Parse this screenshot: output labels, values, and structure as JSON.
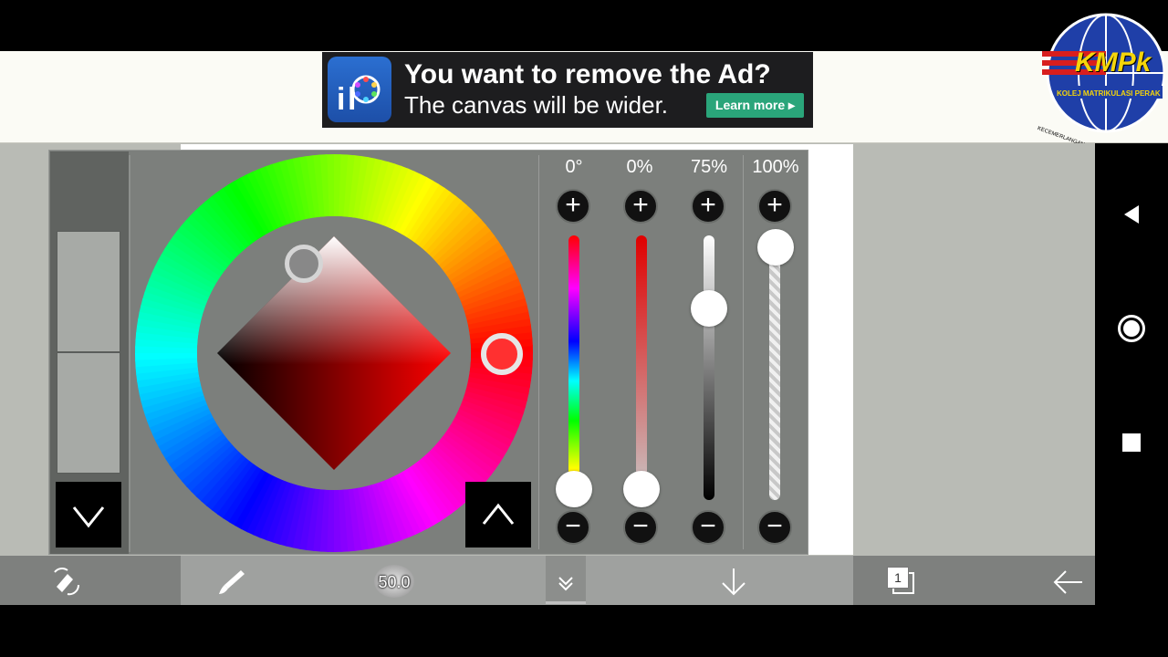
{
  "ad": {
    "title": "You want to remove the Ad?",
    "subtitle": "The canvas will be wider.",
    "learn_more": "Learn more ▸"
  },
  "watermark": {
    "logo_text": "KMPk",
    "name": "KOLEJ MATRIKULASI PERAK",
    "motto": "KECEMERLANGAN MINDA PEMANGKIN NEGARA"
  },
  "color_picker": {
    "hue_label": "0°",
    "saturation_label": "0%",
    "brightness_label": "75%",
    "opacity_label": "100%",
    "hue_value": 0,
    "saturation_value": 0,
    "brightness_value": 0.75,
    "opacity_value": 1.0,
    "current_color": "#bfbfbf",
    "previous_color": "#bfbfbf"
  },
  "toolbar": {
    "brush_size": "50.0",
    "layer_count": "1"
  },
  "icons": {
    "collapse": "chevron-down-icon",
    "expand": "chevron-up-icon",
    "plus": "plus-icon",
    "minus": "minus-icon"
  },
  "colors": {
    "ad_button": "#2aa57a",
    "panel": "#7c7f7c",
    "workarea": "#b9bbb5"
  }
}
